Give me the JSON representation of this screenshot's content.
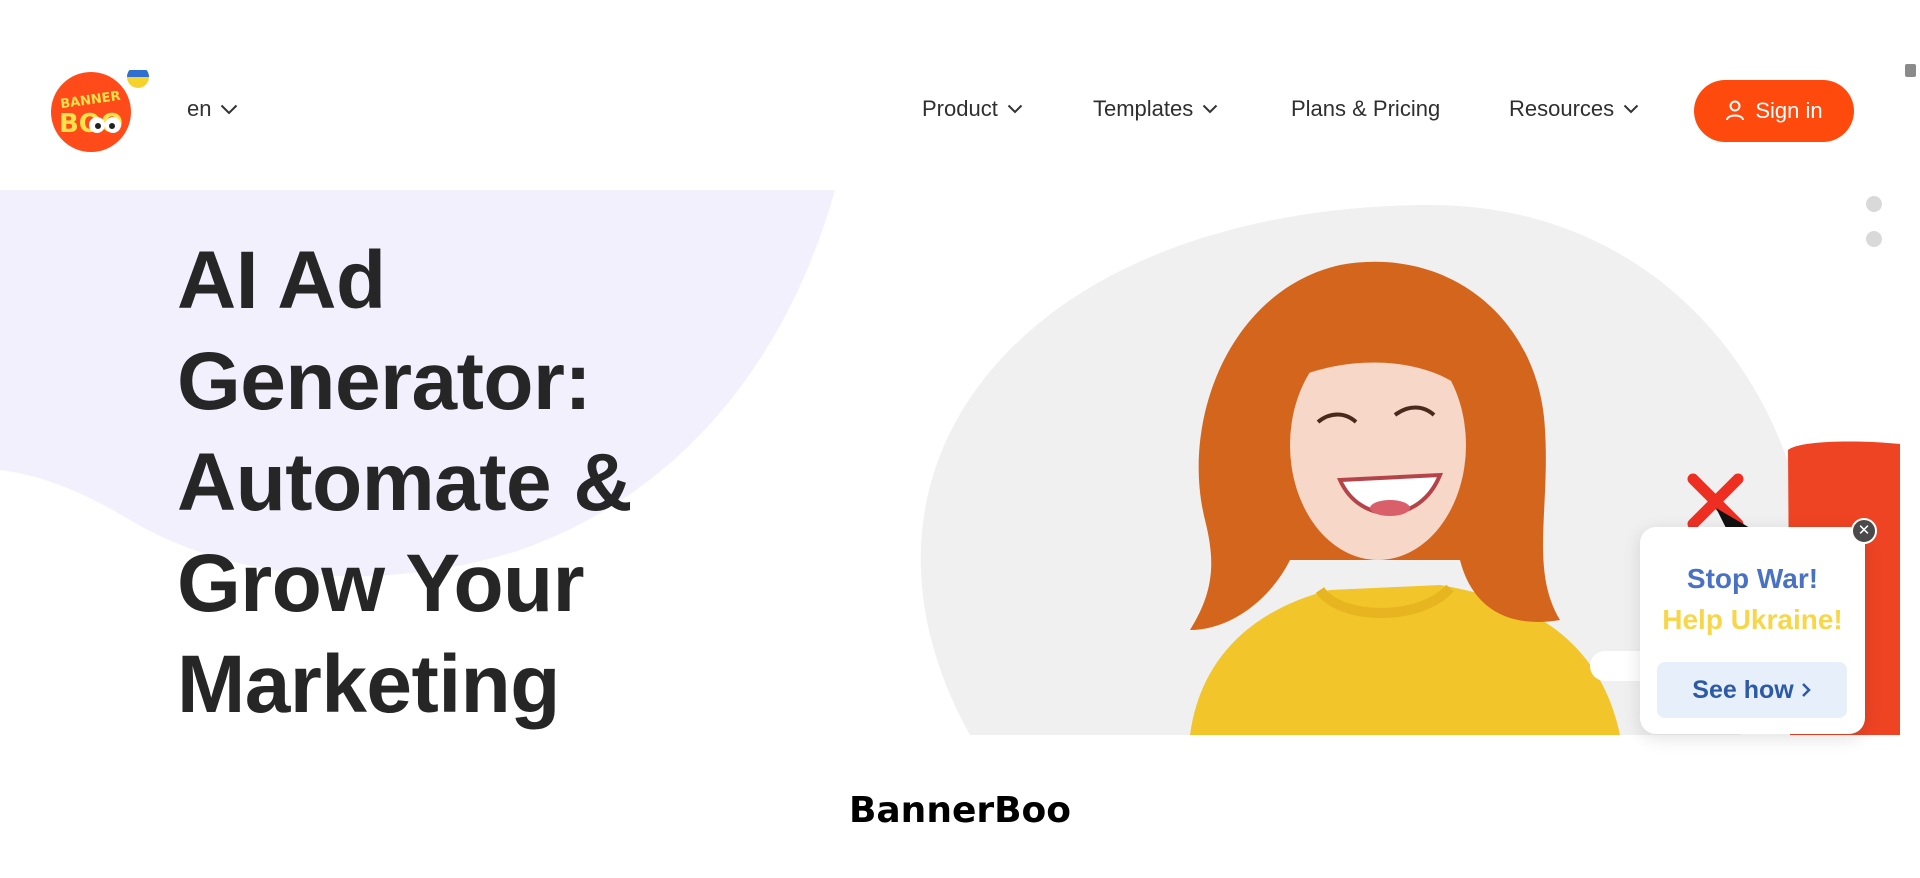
{
  "header": {
    "logo_text_top": "BANNER",
    "logo_text_bottom": "BOO",
    "language": "en",
    "nav": [
      {
        "label": "Product",
        "has_dropdown": true
      },
      {
        "label": "Templates",
        "has_dropdown": true
      },
      {
        "label": "Plans & Pricing",
        "has_dropdown": false
      },
      {
        "label": "Resources",
        "has_dropdown": true
      }
    ],
    "signin_label": "Sign in"
  },
  "hero": {
    "title_lines": [
      "AI Ad",
      "Generator:",
      "Automate &",
      "Grow Your",
      "Marketing"
    ]
  },
  "popup": {
    "line1": "Stop War!",
    "line2": "Help Ukraine!",
    "button_label": "See how",
    "close_icon": "close-icon"
  },
  "caption": "BannerBoo",
  "colors": {
    "accent": "#ff4a0d",
    "text_dark": "#262626",
    "hero_blob": "#f3f0fd",
    "photo_bg": "#f0f0f0",
    "popup_blue": "#4a72c4",
    "popup_yellow": "#f7d64a",
    "popup_button_bg": "#e7f0fa"
  }
}
